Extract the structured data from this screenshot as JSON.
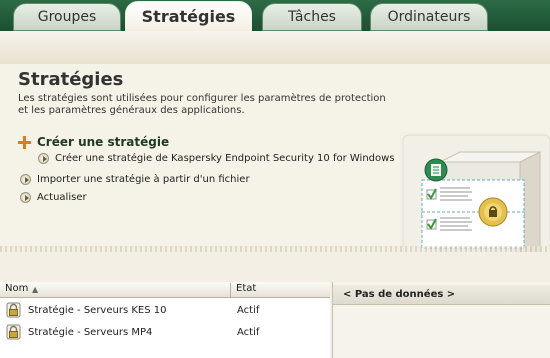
{
  "tabs": [
    {
      "label": "Groupes"
    },
    {
      "label": "Stratégies"
    },
    {
      "label": "Tâches"
    },
    {
      "label": "Ordinateurs"
    }
  ],
  "main": {
    "title": "Stratégies",
    "description": "Les stratégies sont utilisées pour configurer les paramètres de protection et les paramètres généraux des applications.",
    "actions": {
      "create": "Créer une stratégie",
      "create_kes": "Créer une stratégie de Kaspersky Endpoint Security 10 for Windows",
      "import": "Importer une stratégie à partir d'un fichier",
      "refresh": "Actualiser"
    }
  },
  "table": {
    "columns": [
      "Nom",
      "Etat"
    ],
    "rows": [
      {
        "name": "Stratégie - Serveurs KES 10",
        "state": "Actif"
      },
      {
        "name": "Stratégie - Serveurs MP4",
        "state": "Actif"
      }
    ]
  },
  "details": {
    "header": "< Pas de données >"
  },
  "colors": {
    "accent_green": "#1b4f31",
    "plus_orange": "#e07a16"
  }
}
